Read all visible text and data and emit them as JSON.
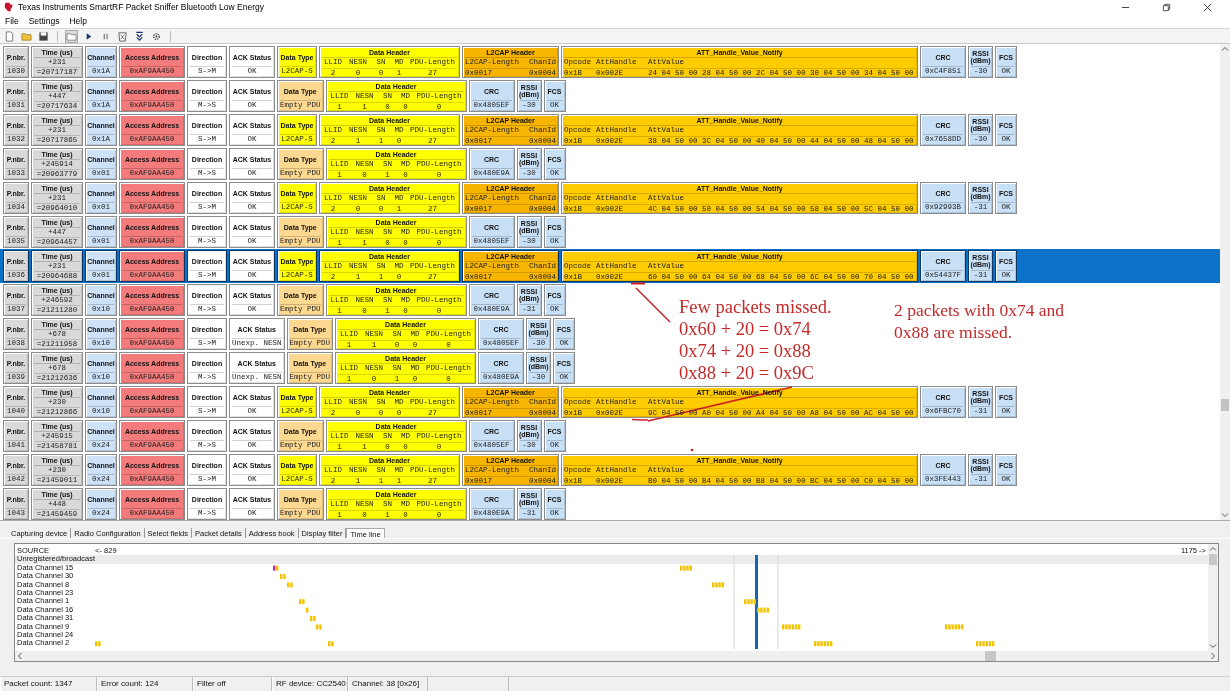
{
  "window": {
    "title": "Texas Instruments SmartRF Packet Sniffer Bluetooth Low Energy"
  },
  "menu": [
    "File",
    "Settings",
    "Help"
  ],
  "packets": [
    {
      "kind": "l2cap",
      "selected": false,
      "pnbr": [
        "P.nbr.",
        "1030"
      ],
      "time": [
        "Time (us)",
        "+231",
        "=20717187"
      ],
      "channel": [
        "Channel",
        "0x1A"
      ],
      "access_address": [
        "Access Address",
        "0xAF9AA450"
      ],
      "direction": [
        "Direction",
        "S->M"
      ],
      "ack_status": [
        "ACK Status",
        "OK"
      ],
      "data_type": [
        "Data Type",
        "L2CAP-S"
      ],
      "data_header": {
        "title": "Data Header",
        "names": [
          "LLID",
          "NESN",
          "SN",
          "MD",
          "PDU-Length"
        ],
        "values": [
          "2",
          "0",
          "0",
          "1",
          "27"
        ]
      },
      "l2cap": {
        "title": "L2CAP Header",
        "names": [
          "L2CAP-Length",
          "ChanId"
        ],
        "values": [
          "0x0017",
          "0x0004"
        ]
      },
      "att": {
        "title": "ATT_Handle_Value_Notify",
        "names": [
          "Opcode",
          "AttHandle",
          "AttValue"
        ],
        "values": [
          "0x1B",
          "0x002E",
          "24 04 50 00 28 04 50 00 2C 04 50 00 30 04 50 00 34 04 50 00"
        ]
      },
      "crc": [
        "CRC",
        "0xC4F851"
      ],
      "rssi": [
        "RSSI (dBm)",
        "-30"
      ],
      "fcs": [
        "FCS",
        "OK"
      ]
    },
    {
      "kind": "empty",
      "selected": false,
      "pnbr": [
        "P.nbr.",
        "1031"
      ],
      "time": [
        "Time (us)",
        "+447",
        "=20717634"
      ],
      "channel": [
        "Channel",
        "0x1A"
      ],
      "access_address": [
        "Access Address",
        "0xAF9AA450"
      ],
      "direction": [
        "Direction",
        "M->S"
      ],
      "ack_status": [
        "ACK Status",
        "OK"
      ],
      "data_type": [
        "Data Type",
        "Empty PDU"
      ],
      "data_header": {
        "title": "Data Header",
        "names": [
          "LLID",
          "NESN",
          "SN",
          "MD",
          "PDU-Length"
        ],
        "values": [
          "1",
          "1",
          "0",
          "0",
          "0"
        ]
      },
      "crc": [
        "CRC",
        "0x4805EF"
      ],
      "rssi": [
        "RSSI (dBm)",
        "-30"
      ],
      "fcs": [
        "FCS",
        "OK"
      ]
    },
    {
      "kind": "l2cap",
      "selected": false,
      "pnbr": [
        "P.nbr.",
        "1032"
      ],
      "time": [
        "Time (us)",
        "+231",
        "=20717865"
      ],
      "channel": [
        "Channel",
        "0x1A"
      ],
      "access_address": [
        "Access Address",
        "0xAF9AA450"
      ],
      "direction": [
        "Direction",
        "S->M"
      ],
      "ack_status": [
        "ACK Status",
        "OK"
      ],
      "data_type": [
        "Data Type",
        "L2CAP-S"
      ],
      "data_header": {
        "title": "Data Header",
        "names": [
          "LLID",
          "NESN",
          "SN",
          "MD",
          "PDU-Length"
        ],
        "values": [
          "2",
          "1",
          "1",
          "0",
          "27"
        ]
      },
      "l2cap": {
        "title": "L2CAP Header",
        "names": [
          "L2CAP-Length",
          "ChanId"
        ],
        "values": [
          "0x0017",
          "0x0004"
        ]
      },
      "att": {
        "title": "ATT_Handle_Value_Notify",
        "names": [
          "Opcode",
          "AttHandle",
          "AttValue"
        ],
        "values": [
          "0x1B",
          "0x002E",
          "38 04 50 00 3C 04 50 00 40 04 50 00 44 04 50 00 48 04 50 00"
        ]
      },
      "crc": [
        "CRC",
        "0x7658DD"
      ],
      "rssi": [
        "RSSI (dBm)",
        "-30"
      ],
      "fcs": [
        "FCS",
        "OK"
      ]
    },
    {
      "kind": "empty",
      "selected": false,
      "pnbr": [
        "P.nbr.",
        "1033"
      ],
      "time": [
        "Time (us)",
        "+245914",
        "=20963779"
      ],
      "channel": [
        "Channel",
        "0x01"
      ],
      "access_address": [
        "Access Address",
        "0xAF9AA450"
      ],
      "direction": [
        "Direction",
        "M->S"
      ],
      "ack_status": [
        "ACK Status",
        "OK"
      ],
      "data_type": [
        "Data Type",
        "Empty PDU"
      ],
      "data_header": {
        "title": "Data Header",
        "names": [
          "LLID",
          "NESN",
          "SN",
          "MD",
          "PDU-Length"
        ],
        "values": [
          "1",
          "0",
          "1",
          "0",
          "0"
        ]
      },
      "crc": [
        "CRC",
        "0x480E9A"
      ],
      "rssi": [
        "RSSI (dBm)",
        "-30"
      ],
      "fcs": [
        "FCS",
        "OK"
      ]
    },
    {
      "kind": "l2cap",
      "selected": false,
      "pnbr": [
        "P.nbr.",
        "1034"
      ],
      "time": [
        "Time (us)",
        "+231",
        "=20964010"
      ],
      "channel": [
        "Channel",
        "0x01"
      ],
      "access_address": [
        "Access Address",
        "0xAF9AA450"
      ],
      "direction": [
        "Direction",
        "S->M"
      ],
      "ack_status": [
        "ACK Status",
        "OK"
      ],
      "data_type": [
        "Data Type",
        "L2CAP-S"
      ],
      "data_header": {
        "title": "Data Header",
        "names": [
          "LLID",
          "NESN",
          "SN",
          "MD",
          "PDU-Length"
        ],
        "values": [
          "2",
          "0",
          "0",
          "1",
          "27"
        ]
      },
      "l2cap": {
        "title": "L2CAP Header",
        "names": [
          "L2CAP-Length",
          "ChanId"
        ],
        "values": [
          "0x0017",
          "0x0004"
        ]
      },
      "att": {
        "title": "ATT_Handle_Value_Notify",
        "names": [
          "Opcode",
          "AttHandle",
          "AttValue"
        ],
        "values": [
          "0x1B",
          "0x002E",
          "4C 04 50 00 50 04 50 00 54 04 50 00 58 04 50 00 5C 04 50 00"
        ]
      },
      "crc": [
        "CRC",
        "0x92993B"
      ],
      "rssi": [
        "RSSI (dBm)",
        "-31"
      ],
      "fcs": [
        "FCS",
        "OK"
      ]
    },
    {
      "kind": "empty",
      "selected": false,
      "pnbr": [
        "P.nbr.",
        "1035"
      ],
      "time": [
        "Time (us)",
        "+447",
        "=20964457"
      ],
      "channel": [
        "Channel",
        "0x01"
      ],
      "access_address": [
        "Access Address",
        "0xAF9AA450"
      ],
      "direction": [
        "Direction",
        "M->S"
      ],
      "ack_status": [
        "ACK Status",
        "OK"
      ],
      "data_type": [
        "Data Type",
        "Empty PDU"
      ],
      "data_header": {
        "title": "Data Header",
        "names": [
          "LLID",
          "NESN",
          "SN",
          "MD",
          "PDU-Length"
        ],
        "values": [
          "1",
          "1",
          "0",
          "0",
          "0"
        ]
      },
      "crc": [
        "CRC",
        "0x4805EF"
      ],
      "rssi": [
        "RSSI (dBm)",
        "-30"
      ],
      "fcs": [
        "FCS",
        "OK"
      ]
    },
    {
      "kind": "l2cap",
      "selected": true,
      "pnbr": [
        "P.nbr.",
        "1036"
      ],
      "time": [
        "Time (us)",
        "+231",
        "=20964688"
      ],
      "channel": [
        "Channel",
        "0x01"
      ],
      "access_address": [
        "Access Address",
        "0xAF9AA450"
      ],
      "direction": [
        "Direction",
        "S->M"
      ],
      "ack_status": [
        "ACK Status",
        "OK"
      ],
      "data_type": [
        "Data Type",
        "L2CAP-S"
      ],
      "data_header": {
        "title": "Data Header",
        "names": [
          "LLID",
          "NESN",
          "SN",
          "MD",
          "PDU-Length"
        ],
        "values": [
          "2",
          "1",
          "1",
          "0",
          "27"
        ]
      },
      "l2cap": {
        "title": "L2CAP Header",
        "names": [
          "L2CAP-Length",
          "ChanId"
        ],
        "values": [
          "0x0017",
          "0x0004"
        ]
      },
      "att": {
        "title": "ATT_Handle_Value_Notify",
        "names": [
          "Opcode",
          "AttHandle",
          "AttValue"
        ],
        "values": [
          "0x1B",
          "0x002E",
          "60 04 50 00 64 04 50 00 68 04 50 00 6C 04 50 00 70 04 50 00"
        ]
      },
      "crc": [
        "CRC",
        "0x54437F"
      ],
      "rssi": [
        "RSSI (dBm)",
        "-31"
      ],
      "fcs": [
        "FCS",
        "OK"
      ]
    },
    {
      "kind": "empty",
      "selected": false,
      "pnbr": [
        "P.nbr.",
        "1037"
      ],
      "time": [
        "Time (us)",
        "+246592",
        "=21211280"
      ],
      "channel": [
        "Channel",
        "0x10"
      ],
      "access_address": [
        "Access Address",
        "0xAF9AA450"
      ],
      "direction": [
        "Direction",
        "M->S"
      ],
      "ack_status": [
        "ACK Status",
        "OK"
      ],
      "data_type": [
        "Data Type",
        "Empty PDU"
      ],
      "data_header": {
        "title": "Data Header",
        "names": [
          "LLID",
          "NESN",
          "SN",
          "MD",
          "PDU-Length"
        ],
        "values": [
          "1",
          "0",
          "1",
          "0",
          "0"
        ]
      },
      "crc": [
        "CRC",
        "0x480E9A"
      ],
      "rssi": [
        "RSSI (dBm)",
        "-31"
      ],
      "fcs": [
        "FCS",
        "OK"
      ]
    },
    {
      "kind": "empty",
      "selected": false,
      "pnbr": [
        "P.nbr.",
        "1038"
      ],
      "time": [
        "Time (us)",
        "+678",
        "=21211958"
      ],
      "channel": [
        "Channel",
        "0x10"
      ],
      "access_address": [
        "Access Address",
        "0xAF9AA450"
      ],
      "direction": [
        "Direction",
        "S->M"
      ],
      "ack_status": [
        "ACK Status",
        "Unexp. NESN"
      ],
      "data_type": [
        "Data Type",
        "Empty PDU"
      ],
      "data_header": {
        "title": "Data Header",
        "names": [
          "LLID",
          "NESN",
          "SN",
          "MD",
          "PDU-Length"
        ],
        "values": [
          "1",
          "1",
          "0",
          "0",
          "0"
        ]
      },
      "crc": [
        "CRC",
        "0x4805EF"
      ],
      "rssi": [
        "RSSI (dBm)",
        "-30"
      ],
      "fcs": [
        "FCS",
        "OK"
      ]
    },
    {
      "kind": "empty",
      "selected": false,
      "pnbr": [
        "P.nbr.",
        "1039"
      ],
      "time": [
        "Time (us)",
        "+678",
        "=21212636"
      ],
      "channel": [
        "Channel",
        "0x10"
      ],
      "access_address": [
        "Access Address",
        "0xAF9AA450"
      ],
      "direction": [
        "Direction",
        "M->S"
      ],
      "ack_status": [
        "ACK Status",
        "Unexp. NESN"
      ],
      "data_type": [
        "Data Type",
        "Empty PDU"
      ],
      "data_header": {
        "title": "Data Header",
        "names": [
          "LLID",
          "NESN",
          "SN",
          "MD",
          "PDU-Length"
        ],
        "values": [
          "1",
          "0",
          "1",
          "0",
          "0"
        ]
      },
      "crc": [
        "CRC",
        "0x480E9A"
      ],
      "rssi": [
        "RSSI (dBm)",
        "-30"
      ],
      "fcs": [
        "FCS",
        "OK"
      ]
    },
    {
      "kind": "l2cap",
      "selected": false,
      "pnbr": [
        "P.nbr.",
        "1040"
      ],
      "time": [
        "Time (us)",
        "+230",
        "=21212866"
      ],
      "channel": [
        "Channel",
        "0x10"
      ],
      "access_address": [
        "Access Address",
        "0xAF9AA450"
      ],
      "direction": [
        "Direction",
        "S->M"
      ],
      "ack_status": [
        "ACK Status",
        "OK"
      ],
      "data_type": [
        "Data Type",
        "L2CAP-S"
      ],
      "data_header": {
        "title": "Data Header",
        "names": [
          "LLID",
          "NESN",
          "SN",
          "MD",
          "PDU-Length"
        ],
        "values": [
          "2",
          "0",
          "0",
          "0",
          "27"
        ]
      },
      "l2cap": {
        "title": "L2CAP Header",
        "names": [
          "L2CAP-Length",
          "ChanId"
        ],
        "values": [
          "0x0017",
          "0x0004"
        ]
      },
      "att": {
        "title": "ATT_Handle_Value_Notify",
        "names": [
          "Opcode",
          "AttHandle",
          "AttValue"
        ],
        "values": [
          "0x1B",
          "0x002E",
          "9C 04 50 00 A0 04 50 00 A4 04 50 00 A8 04 50 00 AC 04 50 00"
        ]
      },
      "crc": [
        "CRC",
        "0x6FBC70"
      ],
      "rssi": [
        "RSSI (dBm)",
        "-31"
      ],
      "fcs": [
        "FCS",
        "OK"
      ]
    },
    {
      "kind": "empty",
      "selected": false,
      "pnbr": [
        "P.nbr.",
        "1041"
      ],
      "time": [
        "Time (us)",
        "+245915",
        "=21458781"
      ],
      "channel": [
        "Channel",
        "0x24"
      ],
      "access_address": [
        "Access Address",
        "0xAF9AA450"
      ],
      "direction": [
        "Direction",
        "M->S"
      ],
      "ack_status": [
        "ACK Status",
        "OK"
      ],
      "data_type": [
        "Data Type",
        "Empty PDU"
      ],
      "data_header": {
        "title": "Data Header",
        "names": [
          "LLID",
          "NESN",
          "SN",
          "MD",
          "PDU-Length"
        ],
        "values": [
          "1",
          "1",
          "0",
          "0",
          "0"
        ]
      },
      "crc": [
        "CRC",
        "0x4805EF"
      ],
      "rssi": [
        "RSSI (dBm)",
        "-30"
      ],
      "fcs": [
        "FCS",
        "OK"
      ]
    },
    {
      "kind": "l2cap",
      "selected": false,
      "pnbr": [
        "P.nbr.",
        "1042"
      ],
      "time": [
        "Time (us)",
        "+230",
        "=21459011"
      ],
      "channel": [
        "Channel",
        "0x24"
      ],
      "access_address": [
        "Access Address",
        "0xAF9AA450"
      ],
      "direction": [
        "Direction",
        "S->M"
      ],
      "ack_status": [
        "ACK Status",
        "OK"
      ],
      "data_type": [
        "Data Type",
        "L2CAP-S"
      ],
      "data_header": {
        "title": "Data Header",
        "names": [
          "LLID",
          "NESN",
          "SN",
          "MD",
          "PDU-Length"
        ],
        "values": [
          "2",
          "1",
          "1",
          "1",
          "27"
        ]
      },
      "l2cap": {
        "title": "L2CAP Header",
        "names": [
          "L2CAP-Length",
          "ChanId"
        ],
        "values": [
          "0x0017",
          "0x0004"
        ]
      },
      "att": {
        "title": "ATT_Handle_Value_Notify",
        "names": [
          "Opcode",
          "AttHandle",
          "AttValue"
        ],
        "values": [
          "0x1B",
          "0x002E",
          "B0 04 50 00 B4 04 50 00 B8 04 50 00 BC 04 50 00 C0 04 50 00"
        ]
      },
      "crc": [
        "CRC",
        "0x3FE443"
      ],
      "rssi": [
        "RSSI (dBm)",
        "-31"
      ],
      "fcs": [
        "FCS",
        "OK"
      ]
    },
    {
      "kind": "empty",
      "selected": false,
      "pnbr": [
        "P.nbr.",
        "1043"
      ],
      "time": [
        "Time (us)",
        "+448",
        "=21459459"
      ],
      "channel": [
        "Channel",
        "0x24"
      ],
      "access_address": [
        "Access Address",
        "0xAF9AA450"
      ],
      "direction": [
        "Direction",
        "M->S"
      ],
      "ack_status": [
        "ACK Status",
        "OK"
      ],
      "data_type": [
        "Data Type",
        "Empty PDU"
      ],
      "data_header": {
        "title": "Data Header",
        "names": [
          "LLID",
          "NESN",
          "SN",
          "MD",
          "PDU-Length"
        ],
        "values": [
          "1",
          "0",
          "1",
          "0",
          "0"
        ]
      },
      "crc": [
        "CRC",
        "0x480E9A"
      ],
      "rssi": [
        "RSSI (dBm)",
        "-31"
      ],
      "fcs": [
        "FCS",
        "OK"
      ]
    }
  ],
  "annotations": [
    {
      "lines": [
        "Few packets missed.",
        "0x60 + 20 = 0x74",
        "0x74 + 20 = 0x88",
        "0x88 + 20 = 0x9C"
      ]
    },
    {
      "lines": [
        "2 packets with 0x74 and",
        "0x88 are missed."
      ]
    }
  ],
  "tabs": [
    {
      "label": "Capturing device",
      "selected": false
    },
    {
      "label": "Radio Configuration",
      "selected": false
    },
    {
      "label": "Select fields",
      "selected": false
    },
    {
      "label": "Packet details",
      "selected": false
    },
    {
      "label": "Address book",
      "selected": false
    },
    {
      "label": "Display filter",
      "selected": false
    },
    {
      "label": "Time line",
      "selected": true
    }
  ],
  "timeline": {
    "source_label": "SOURCE",
    "left_marker": "<- 829",
    "right_marker": "1175 ->",
    "sources": [
      "Unregistered/broadcast",
      "Data Channel 15",
      "Data Channel 30",
      "Data Channel 8",
      "Data Channel 23",
      "Data Channel 1",
      "Data Channel 16",
      "Data Channel 31",
      "Data Channel 9",
      "Data Channel 24",
      "Data Channel 2"
    ]
  },
  "status_bar": [
    "Packet count: 1347",
    "Error count: 124",
    "Filter off",
    "RF device: CC2540",
    "Channel: 38 [0x26]"
  ]
}
